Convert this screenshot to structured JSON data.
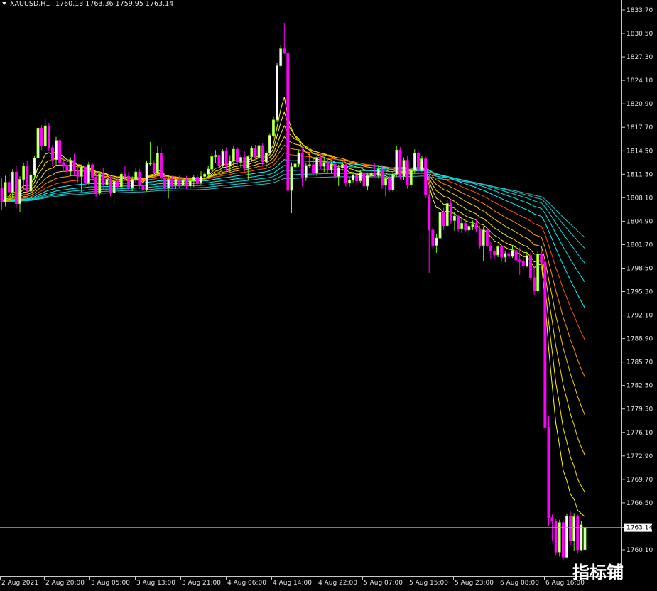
{
  "header": {
    "symbol": "XAUUSD,H1",
    "ohlc": "1760.13 1763.36 1759.95 1763.14"
  },
  "watermark": "指标铺",
  "colors": {
    "background": "#000000",
    "bull": "#ffffff",
    "bull_edge": "#7cfc00",
    "bear": "#ff00ff",
    "ema_fast": "#ffff00",
    "ema_mid": "#ff0000",
    "ema_slow": "#00ffff",
    "axis": "#c8c8c8",
    "price_line": "#9aa6b2"
  },
  "chart_data": {
    "type": "candlestick",
    "symbol": "XAUUSD",
    "timeframe": "H1",
    "y_ticks": [
      "1833.70",
      "1830.50",
      "1827.30",
      "1824.10",
      "1820.90",
      "1817.70",
      "1814.50",
      "1811.30",
      "1808.10",
      "1804.90",
      "1801.70",
      "1798.50",
      "1795.30",
      "1792.10",
      "1788.90",
      "1785.70",
      "1782.50",
      "1779.30",
      "1776.10",
      "1772.90",
      "1769.70",
      "1766.50",
      "1763.14",
      "1760.10"
    ],
    "ylim": [
      1757.4,
      1835.0
    ],
    "x_ticks": [
      "2 Aug 2021",
      "2 Aug 20:00",
      "3 Aug 05:00",
      "3 Aug 13:00",
      "3 Aug 21:00",
      "4 Aug 06:00",
      "4 Aug 14:00",
      "4 Aug 22:00",
      "5 Aug 07:00",
      "5 Aug 15:00",
      "5 Aug 23:00",
      "6 Aug 08:00",
      "6 Aug 16:00"
    ],
    "current_price": 1763.14,
    "candles_key": [
      "open",
      "high",
      "low",
      "close"
    ],
    "candles": [
      [
        1809.4,
        1810.8,
        1806.4,
        1807.5
      ],
      [
        1807.5,
        1811.1,
        1806.9,
        1810.2
      ],
      [
        1810.2,
        1811.3,
        1808.0,
        1808.9
      ],
      [
        1808.9,
        1812.0,
        1808.0,
        1811.6
      ],
      [
        1811.6,
        1812.4,
        1806.6,
        1807.3
      ],
      [
        1807.3,
        1811.0,
        1806.2,
        1810.6
      ],
      [
        1810.6,
        1812.9,
        1809.3,
        1812.4
      ],
      [
        1812.4,
        1813.1,
        1808.5,
        1809.0
      ],
      [
        1809.0,
        1811.6,
        1808.4,
        1811.2
      ],
      [
        1811.2,
        1813.8,
        1810.6,
        1813.5
      ],
      [
        1813.5,
        1817.9,
        1813.1,
        1817.6
      ],
      [
        1817.6,
        1818.0,
        1814.6,
        1815.2
      ],
      [
        1815.2,
        1818.8,
        1814.9,
        1817.9
      ],
      [
        1817.9,
        1818.3,
        1814.5,
        1814.9
      ],
      [
        1814.9,
        1815.3,
        1812.5,
        1813.3
      ],
      [
        1813.3,
        1816.4,
        1812.6,
        1815.9
      ],
      [
        1815.9,
        1816.1,
        1812.5,
        1812.9
      ],
      [
        1812.9,
        1813.6,
        1811.6,
        1812.4
      ],
      [
        1812.4,
        1813.0,
        1811.2,
        1811.7
      ],
      [
        1811.7,
        1813.6,
        1811.2,
        1813.2
      ],
      [
        1813.2,
        1814.1,
        1811.2,
        1811.8
      ],
      [
        1811.8,
        1812.5,
        1810.2,
        1811.0
      ],
      [
        1811.0,
        1812.6,
        1808.9,
        1812.3
      ],
      [
        1812.3,
        1812.5,
        1809.7,
        1810.2
      ],
      [
        1810.2,
        1813.0,
        1809.9,
        1812.6
      ],
      [
        1812.6,
        1812.9,
        1810.4,
        1810.9
      ],
      [
        1810.9,
        1811.6,
        1808.2,
        1808.8
      ],
      [
        1808.8,
        1811.6,
        1808.4,
        1811.3
      ],
      [
        1811.3,
        1812.2,
        1809.3,
        1809.9
      ],
      [
        1809.9,
        1811.0,
        1808.9,
        1810.6
      ],
      [
        1810.6,
        1811.1,
        1808.3,
        1808.8
      ],
      [
        1808.8,
        1810.7,
        1807.3,
        1810.3
      ],
      [
        1810.3,
        1810.9,
        1809.2,
        1809.6
      ],
      [
        1809.6,
        1811.6,
        1809.4,
        1811.3
      ],
      [
        1811.3,
        1812.4,
        1810.6,
        1811.0
      ],
      [
        1811.0,
        1811.6,
        1809.0,
        1809.5
      ],
      [
        1809.5,
        1811.0,
        1809.0,
        1810.6
      ],
      [
        1810.6,
        1812.1,
        1810.2,
        1811.6
      ],
      [
        1811.6,
        1812.0,
        1809.3,
        1809.8
      ],
      [
        1809.8,
        1810.2,
        1806.7,
        1809.2
      ],
      [
        1809.2,
        1813.2,
        1809.0,
        1812.8
      ],
      [
        1812.8,
        1815.7,
        1812.5,
        1812.8
      ],
      [
        1812.8,
        1813.2,
        1811.0,
        1811.5
      ],
      [
        1811.5,
        1815.1,
        1811.1,
        1814.2
      ],
      [
        1814.2,
        1815.0,
        1810.3,
        1810.8
      ],
      [
        1810.8,
        1811.5,
        1808.9,
        1809.4
      ],
      [
        1809.4,
        1811.2,
        1808.0,
        1810.6
      ],
      [
        1810.6,
        1811.2,
        1809.3,
        1809.8
      ],
      [
        1809.8,
        1811.0,
        1809.3,
        1810.6
      ],
      [
        1810.6,
        1811.1,
        1809.4,
        1809.8
      ],
      [
        1809.8,
        1810.9,
        1809.2,
        1810.5
      ],
      [
        1810.5,
        1811.1,
        1809.3,
        1809.7
      ],
      [
        1809.7,
        1810.9,
        1809.2,
        1810.4
      ],
      [
        1810.4,
        1811.2,
        1809.6,
        1810.9
      ],
      [
        1810.9,
        1811.3,
        1809.9,
        1810.2
      ],
      [
        1810.2,
        1811.7,
        1809.9,
        1811.0
      ],
      [
        1811.0,
        1811.6,
        1810.5,
        1811.3
      ],
      [
        1811.3,
        1812.5,
        1810.9,
        1812.0
      ],
      [
        1812.0,
        1814.2,
        1811.7,
        1813.7
      ],
      [
        1813.7,
        1814.6,
        1812.8,
        1813.9
      ],
      [
        1813.9,
        1814.6,
        1811.9,
        1812.5
      ],
      [
        1812.5,
        1814.7,
        1812.2,
        1814.4
      ],
      [
        1814.4,
        1815.0,
        1811.7,
        1812.4
      ],
      [
        1812.4,
        1813.9,
        1811.5,
        1813.1
      ],
      [
        1813.1,
        1815.2,
        1812.5,
        1814.7
      ],
      [
        1814.7,
        1815.0,
        1812.5,
        1813.0
      ],
      [
        1813.0,
        1813.9,
        1812.2,
        1813.6
      ],
      [
        1813.6,
        1814.5,
        1811.6,
        1812.1
      ],
      [
        1812.1,
        1813.9,
        1810.5,
        1813.7
      ],
      [
        1813.7,
        1815.2,
        1813.0,
        1814.8
      ],
      [
        1814.8,
        1815.3,
        1813.2,
        1813.6
      ],
      [
        1813.6,
        1815.6,
        1813.4,
        1815.2
      ],
      [
        1815.2,
        1815.5,
        1812.5,
        1813.0
      ],
      [
        1813.0,
        1814.5,
        1812.1,
        1814.2
      ],
      [
        1814.2,
        1816.9,
        1813.9,
        1816.6
      ],
      [
        1816.6,
        1819.1,
        1816.3,
        1818.7
      ],
      [
        1818.7,
        1826.5,
        1818.4,
        1826.1
      ],
      [
        1826.1,
        1828.9,
        1825.8,
        1828.4
      ],
      [
        1828.4,
        1831.9,
        1827.7,
        1827.8
      ],
      [
        1827.8,
        1828.9,
        1808.6,
        1809.1
      ],
      [
        1809.1,
        1812.9,
        1806.0,
        1812.3
      ],
      [
        1812.3,
        1814.0,
        1811.0,
        1812.7
      ],
      [
        1812.7,
        1814.6,
        1812.3,
        1814.2
      ],
      [
        1814.2,
        1815.0,
        1809.6,
        1810.9
      ],
      [
        1810.9,
        1812.9,
        1810.4,
        1812.5
      ],
      [
        1812.5,
        1814.3,
        1812.2,
        1812.6
      ],
      [
        1812.6,
        1813.6,
        1811.1,
        1811.5
      ],
      [
        1811.5,
        1813.8,
        1811.0,
        1813.5
      ],
      [
        1813.5,
        1814.0,
        1812.0,
        1812.4
      ],
      [
        1812.4,
        1813.5,
        1811.6,
        1812.9
      ],
      [
        1812.9,
        1813.5,
        1811.4,
        1811.9
      ],
      [
        1811.9,
        1813.0,
        1811.4,
        1812.7
      ],
      [
        1812.7,
        1813.3,
        1810.6,
        1811.0
      ],
      [
        1811.0,
        1812.6,
        1809.7,
        1812.2
      ],
      [
        1812.2,
        1813.1,
        1811.7,
        1812.6
      ],
      [
        1812.6,
        1812.8,
        1809.6,
        1810.1
      ],
      [
        1810.1,
        1810.9,
        1809.6,
        1810.5
      ],
      [
        1810.5,
        1811.6,
        1810.2,
        1811.2
      ],
      [
        1811.2,
        1811.5,
        1809.9,
        1810.4
      ],
      [
        1810.4,
        1811.8,
        1810.1,
        1811.5
      ],
      [
        1811.5,
        1811.7,
        1809.3,
        1809.7
      ],
      [
        1809.7,
        1811.5,
        1809.2,
        1811.1
      ],
      [
        1811.1,
        1811.7,
        1810.7,
        1811.4
      ],
      [
        1811.4,
        1812.8,
        1810.9,
        1811.1
      ],
      [
        1811.1,
        1812.4,
        1810.7,
        1812.0
      ],
      [
        1812.0,
        1812.6,
        1809.3,
        1809.8
      ],
      [
        1809.8,
        1810.9,
        1808.3,
        1810.7
      ],
      [
        1810.7,
        1811.5,
        1808.9,
        1809.2
      ],
      [
        1809.2,
        1811.7,
        1808.9,
        1811.3
      ],
      [
        1811.3,
        1815.2,
        1811.0,
        1814.6
      ],
      [
        1814.6,
        1815.0,
        1810.6,
        1811.0
      ],
      [
        1811.0,
        1813.6,
        1810.5,
        1813.2
      ],
      [
        1813.2,
        1813.8,
        1809.3,
        1809.9
      ],
      [
        1809.9,
        1812.1,
        1809.4,
        1811.8
      ],
      [
        1811.8,
        1814.7,
        1811.5,
        1814.2
      ],
      [
        1814.2,
        1814.6,
        1811.4,
        1811.9
      ],
      [
        1811.9,
        1813.8,
        1811.6,
        1813.4
      ],
      [
        1813.4,
        1813.8,
        1808.0,
        1808.5
      ],
      [
        1808.5,
        1811.3,
        1797.8,
        1803.7
      ],
      [
        1803.7,
        1804.1,
        1801.1,
        1801.6
      ],
      [
        1801.6,
        1803.2,
        1800.6,
        1802.6
      ],
      [
        1802.6,
        1806.5,
        1802.1,
        1806.1
      ],
      [
        1806.1,
        1806.7,
        1803.7,
        1804.3
      ],
      [
        1804.3,
        1807.8,
        1804.0,
        1807.3
      ],
      [
        1807.3,
        1807.8,
        1804.5,
        1805.0
      ],
      [
        1805.0,
        1806.2,
        1803.6,
        1805.6
      ],
      [
        1805.6,
        1805.8,
        1803.5,
        1803.9
      ],
      [
        1803.9,
        1805.2,
        1803.3,
        1804.6
      ],
      [
        1804.6,
        1805.1,
        1803.4,
        1803.7
      ],
      [
        1803.7,
        1804.6,
        1803.3,
        1804.2
      ],
      [
        1804.2,
        1805.0,
        1803.7,
        1804.4
      ],
      [
        1804.4,
        1805.1,
        1803.4,
        1803.8
      ],
      [
        1803.8,
        1804.3,
        1801.2,
        1801.6
      ],
      [
        1801.6,
        1804.2,
        1799.5,
        1803.7
      ],
      [
        1803.7,
        1804.0,
        1801.1,
        1801.5
      ],
      [
        1801.5,
        1802.1,
        1799.7,
        1800.8
      ],
      [
        1800.8,
        1801.2,
        1799.8,
        1800.3
      ],
      [
        1800.3,
        1801.6,
        1800.0,
        1801.4
      ],
      [
        1801.4,
        1801.6,
        1799.4,
        1800.0
      ],
      [
        1800.0,
        1800.8,
        1799.3,
        1800.5
      ],
      [
        1800.5,
        1801.2,
        1799.7,
        1800.1
      ],
      [
        1800.1,
        1801.5,
        1799.9,
        1800.9
      ],
      [
        1800.9,
        1801.0,
        1799.1,
        1799.6
      ],
      [
        1799.6,
        1801.3,
        1797.6,
        1799.4
      ],
      [
        1799.4,
        1800.7,
        1798.3,
        1798.8
      ],
      [
        1798.8,
        1800.7,
        1798.6,
        1800.2
      ],
      [
        1800.2,
        1800.6,
        1796.9,
        1797.2
      ],
      [
        1797.2,
        1798.8,
        1794.8,
        1795.4
      ],
      [
        1795.4,
        1800.9,
        1795.0,
        1800.4
      ],
      [
        1800.4,
        1801.0,
        1798.6,
        1799.3
      ],
      [
        1799.3,
        1800.9,
        1776.2,
        1776.8
      ],
      [
        1776.8,
        1778.4,
        1763.3,
        1764.5
      ],
      [
        1764.5,
        1764.9,
        1761.3,
        1764.0
      ],
      [
        1764.0,
        1764.3,
        1759.3,
        1759.8
      ],
      [
        1759.8,
        1764.2,
        1759.2,
        1763.8
      ],
      [
        1763.8,
        1764.2,
        1758.6,
        1759.1
      ],
      [
        1759.1,
        1765.0,
        1758.9,
        1764.7
      ],
      [
        1764.7,
        1765.3,
        1760.8,
        1761.3
      ],
      [
        1761.3,
        1765.1,
        1760.0,
        1764.6
      ],
      [
        1764.6,
        1764.9,
        1759.6,
        1760.1
      ],
      [
        1760.1,
        1764.0,
        1759.9,
        1763.5
      ],
      [
        1760.13,
        1763.36,
        1759.95,
        1763.14
      ]
    ],
    "ema_periods": [
      8,
      12,
      18,
      26,
      36,
      50,
      68,
      90,
      115,
      145,
      180
    ],
    "ema_colors": [
      "#ffff00",
      "#fff000",
      "#ffe000",
      "#ffcc00",
      "#ff9900",
      "#ff5500",
      "#00ffff",
      "#00eeee",
      "#00dddd",
      "#20c8c8",
      "#30b8c0"
    ],
    "grid": false,
    "legend": "none"
  }
}
